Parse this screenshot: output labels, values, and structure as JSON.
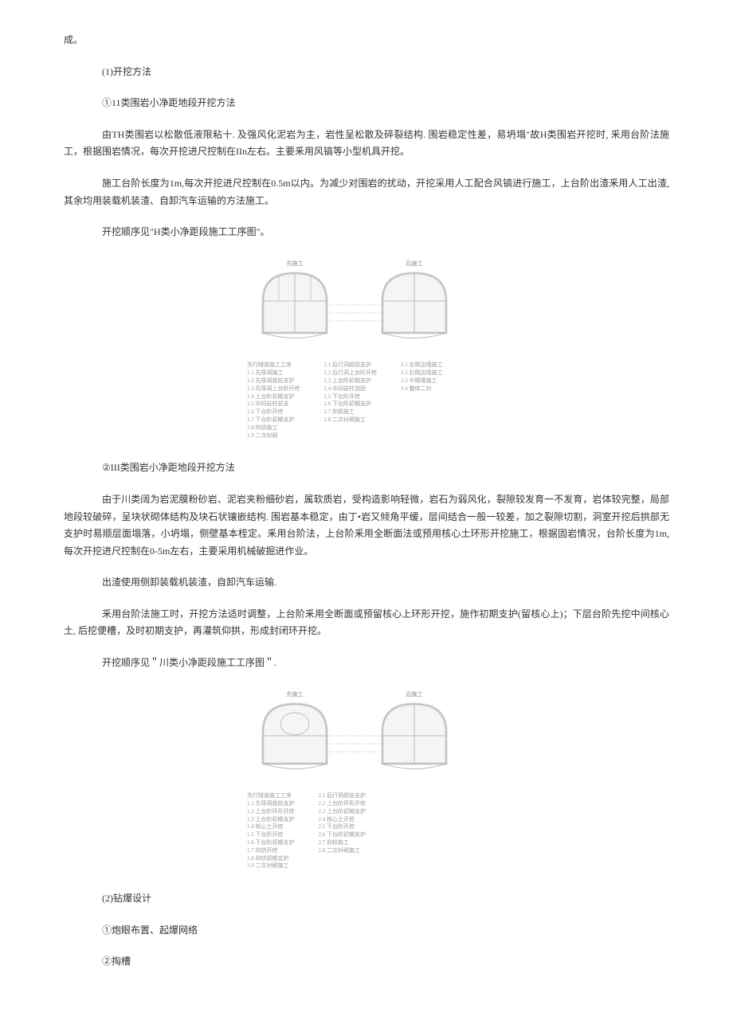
{
  "p1": "成。",
  "h1": "(1)开挖方法",
  "h2": "①11类围岩小净距地段开挖方法",
  "p2": "由TH类围岩以松散低液限粘十. 及强风化泥岩为主，岩性呈松散及碎裂结构. 围岩稳定性差，易坍塌\"故H类围岩开挖时, 釆用台阶法施工，根据围岩情况，每次开挖进尺控制在IIn左右。主要釆用风镐等小型机具开挖。",
  "p3": "施工台阶长度为1m,每次开挖进尺控制在0.5m以内。为减少对围岩的扰动，开挖采用人工配合风镐进行施工，上台阶出渣釆用人工出渣, 其余均用装载机装渣、自卸汽车运输的方法施工。",
  "p4": "开挖顺序见\"H类小净距段施工工序图\"。",
  "h3": "②III类围岩小净距地段开挖方法",
  "p5": "由于川类阔为岩泥膜粉砂岩、泥岩夹粉细砂岩，属软质岩，受构造影响轻微，岩石为弱风化，裂隙较发育一不发育，岩体较完整，局部地段较破碎，呈块状砌体结构及块石状镶嵌结构. 围岩基本稳定，由丁•岩又倾角平缓，层间结合一般一较差，加之裂隙切割，洞室开挖后拱部无支护时易顺层面塌落，小坍塌，侧壁基本桎定。釆用台阶法，上台阶釆用全断面法或预用核心土环形开挖施工，根据固岩情况，台阶长度为1m,每次开挖进尺控制在0-5m左右，主要采用机械破掘进作业。",
  "p6": "出渣使用侧卸装载机装渣，自卸汽车运输.",
  "p7": "釆用台阶法施工时，开挖方法适时调整，上台阶釆用全断面或预留核心上环形开挖，施作初期支护(留核心上)；下层台阶先挖中间核心土, 后挖便槽，及时初期支护，再灌筑仰拱，形成封闭环开挖。",
  "p8": "开挖顺序见＂川类小净距段施工工序图＂.",
  "h4": "(2)钻爆设计",
  "h5": "①炮眼布置、起爆网络",
  "h6": "②掏槽",
  "diagram1": {
    "leftLabel": "先施工",
    "rightLabel": "后施工",
    "legendTitle": "先行隧道施工工序",
    "legend1": [
      "1.1 先导洞施工",
      "1.2 先导洞超前支护",
      "1.3 先导洞上台阶开挖",
      "1.4 上台阶初期支护",
      "1.5 中间岩柱初支",
      "1.6 下台阶开挖",
      "1.7 下台阶初期支护",
      "1.8 仰拱施工",
      "1.9 二次衬砌"
    ],
    "legend2": [
      "2.1 后行洞超前支护",
      "2.2 后行洞上台阶开挖",
      "2.3 上台阶初期支护",
      "2.4 中间岩柱加固",
      "2.5 下台阶开挖",
      "2.6 下台阶初期支护",
      "2.7 仰拱施工",
      "2.8 二次衬砌施工"
    ],
    "legend3": [
      "3.1 左侧边墙施工",
      "3.2 右侧边墙施工",
      "3.3 中隔墙施工",
      "3.4 整体二衬"
    ]
  },
  "diagram2": {
    "leftLabel": "先施工",
    "rightLabel": "后施工",
    "legendTitle": "先行隧道施工工序",
    "legend1": [
      "1.1 先导洞超前支护",
      "1.2 上台阶环形开挖",
      "1.3 上台阶初期支护",
      "1.4 核心土开挖",
      "1.5 下台阶开挖",
      "1.6 下台阶初期支护",
      "1.7 仰拱开挖",
      "1.8 仰拱初期支护",
      "1.9 二次衬砌施工"
    ],
    "legend2": [
      "2.1 后行洞超前支护",
      "2.2 上台阶环形开挖",
      "2.3 上台阶初期支护",
      "2.4 核心土开挖",
      "2.5 下台阶开挖",
      "2.6 下台阶初期支护",
      "2.7 仰拱施工",
      "2.8 二次衬砌施工"
    ]
  }
}
